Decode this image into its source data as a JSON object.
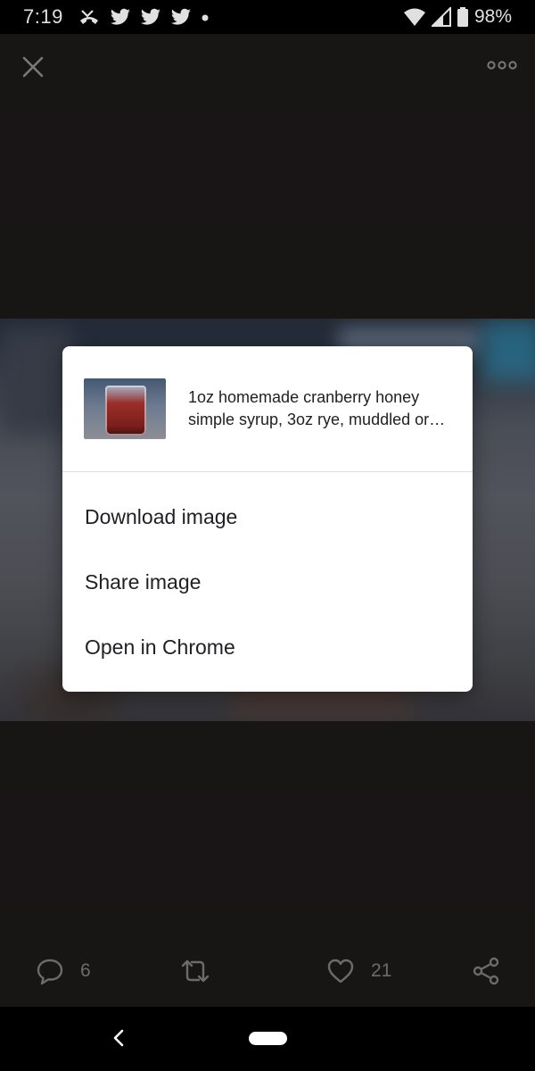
{
  "status_bar": {
    "time": "7:19",
    "battery": "98%",
    "left_icons": [
      "missed-call-icon",
      "twitter-bird-icon",
      "twitter-bird-icon",
      "twitter-bird-icon",
      "dot-icon"
    ],
    "right_icons": [
      "wifi-icon",
      "cell-signal-icon",
      "battery-icon"
    ]
  },
  "top_bar": {
    "close_icon": "close-icon",
    "more_icon": "more-options-icon"
  },
  "dialog": {
    "caption": "1oz homemade cranberry honey simple syrup, 3oz rye, muddled or…",
    "menu_items": [
      {
        "label": "Download image"
      },
      {
        "label": "Share image"
      },
      {
        "label": "Open in Chrome"
      }
    ]
  },
  "actions": {
    "reply_count": "6",
    "retweet_count": "",
    "like_count": "21"
  },
  "colors": {
    "background": "#1c1819",
    "dialog_bg": "#ffffff",
    "action_icon": "#6b6b6b"
  }
}
